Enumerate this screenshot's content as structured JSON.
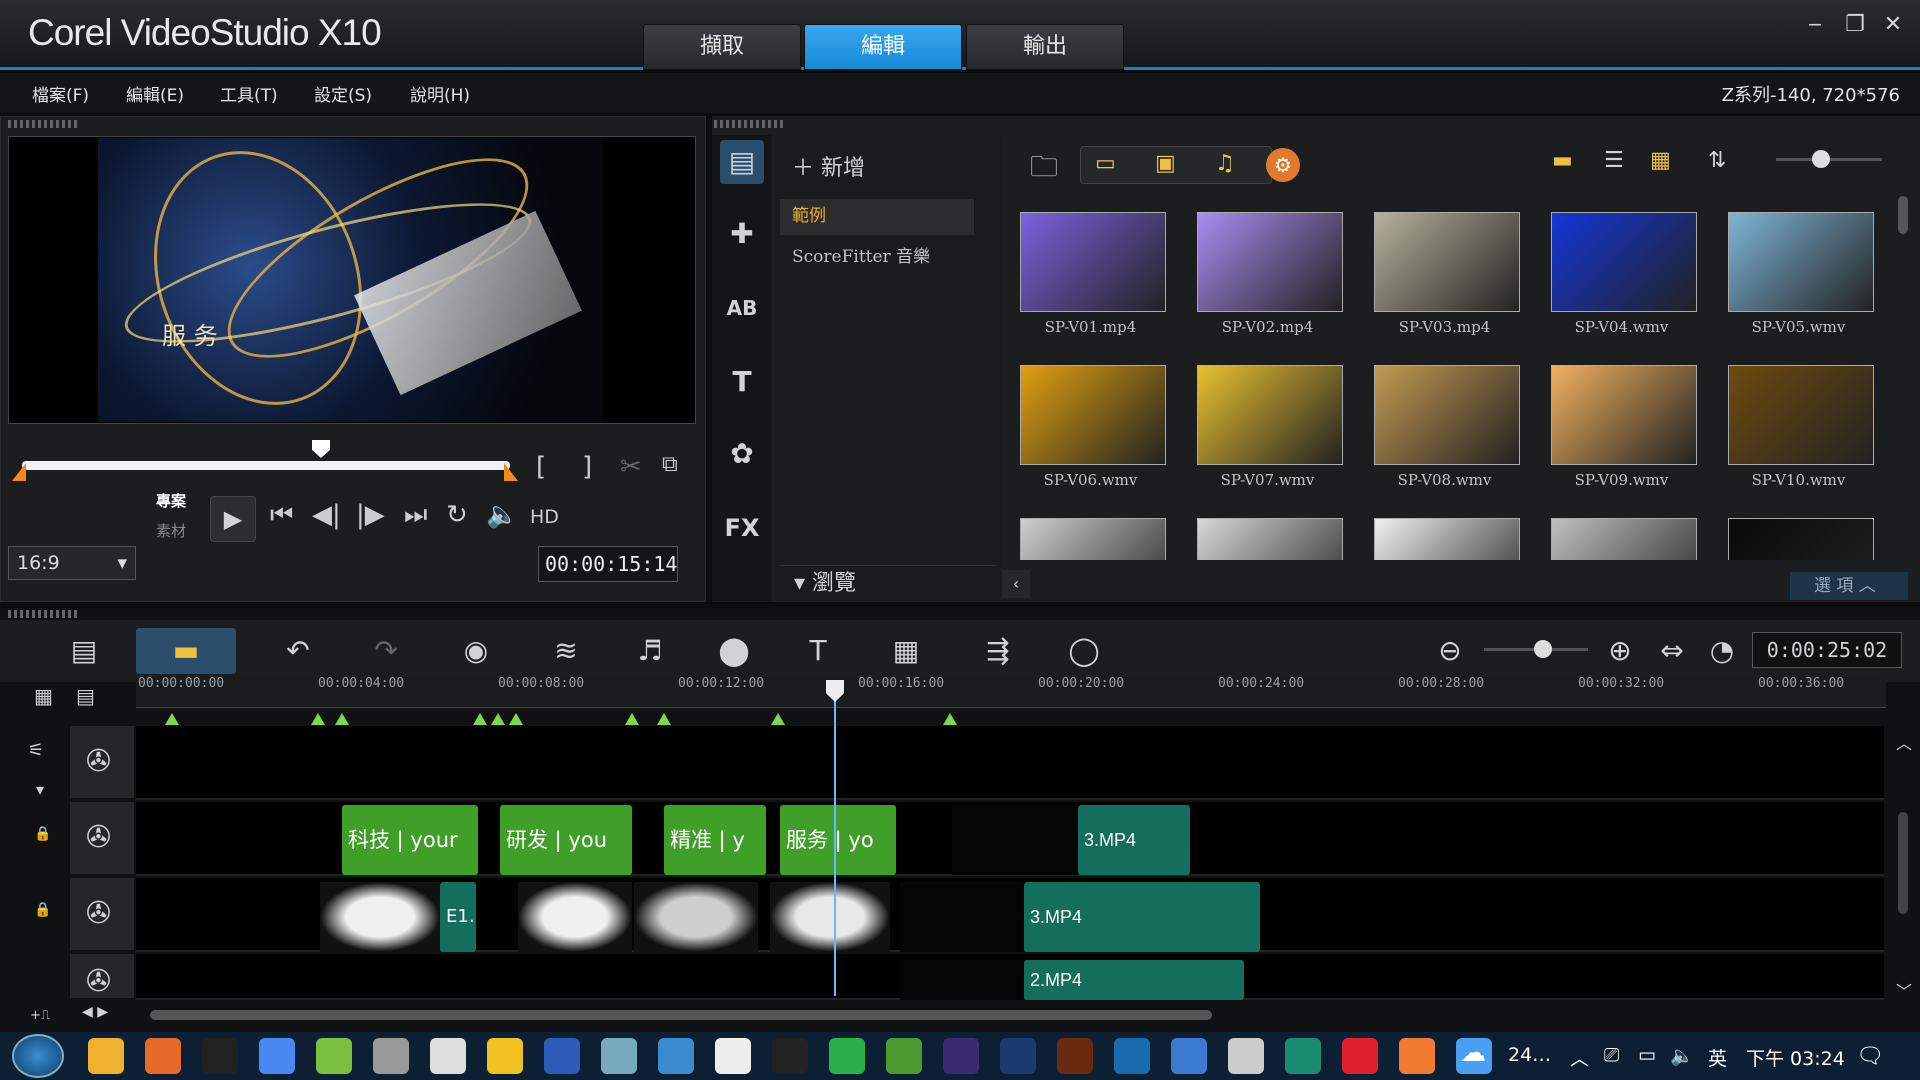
{
  "app": {
    "brand": "Corel VideoStudio X10",
    "tabs": [
      "擷取",
      "編輯",
      "輸出"
    ],
    "active_tab": "編輯",
    "win": [
      "‒",
      "❐",
      "✕"
    ]
  },
  "menu": [
    "檔案(F)",
    "編輯(E)",
    "工具(T)",
    "設定(S)",
    "說明(H)"
  ],
  "project_info": "Z系列-140, 720*576",
  "player": {
    "video_text": "服 务",
    "mode_project": "專案",
    "mode_clip": "素材",
    "hd": "HD",
    "aspect": "16:9",
    "timecode": "00:00:15:14"
  },
  "library": {
    "add_label": "新增",
    "folders": [
      "範例",
      "ScoreFitter 音樂"
    ],
    "browse": "瀏覽",
    "options": "選 項",
    "items": [
      {
        "name": "SP-V01.mp4",
        "color": "#7a63e0"
      },
      {
        "name": "SP-V02.mp4",
        "color": "#a98df0"
      },
      {
        "name": "SP-V03.mp4",
        "color": "#b7b29c"
      },
      {
        "name": "SP-V04.wmv",
        "color": "#1336d8"
      },
      {
        "name": "SP-V05.wmv",
        "color": "#7fb5d8"
      },
      {
        "name": "SP-V06.wmv",
        "color": "#e0a010"
      },
      {
        "name": "SP-V07.wmv",
        "color": "#e8c030"
      },
      {
        "name": "SP-V08.wmv",
        "color": "#c49a52"
      },
      {
        "name": "SP-V09.wmv",
        "color": "#f0b060"
      },
      {
        "name": "SP-V10.wmv",
        "color": "#6e4a10"
      },
      {
        "name": "",
        "color": "#cfcfcf"
      },
      {
        "name": "",
        "color": "#d8d8d8"
      },
      {
        "name": "",
        "color": "#f0f0f0"
      },
      {
        "name": "",
        "color": "#c0c0c0"
      },
      {
        "name": "",
        "color": "#0a0a0a"
      }
    ]
  },
  "timeline": {
    "timecode": "0:00:25:02",
    "ruler": [
      "00:00:00:00",
      "00:00:04:00",
      "00:00:08:00",
      "00:00:12:00",
      "00:00:16:00",
      "00:00:20:00",
      "00:00:24:00",
      "00:00:28:00",
      "00:00:32:00",
      "00:00:36:00"
    ],
    "track2_clips": [
      "科技 | your",
      "研发 | you",
      "精准 | y",
      "服务 | yo",
      "3.MP4"
    ],
    "track3_clips": [
      "E1.",
      "3.MP4"
    ],
    "track4_clips": [
      "2.MP4"
    ]
  },
  "taskbar": {
    "weather": "24…",
    "lang": "英",
    "time": "下午 03:24"
  }
}
